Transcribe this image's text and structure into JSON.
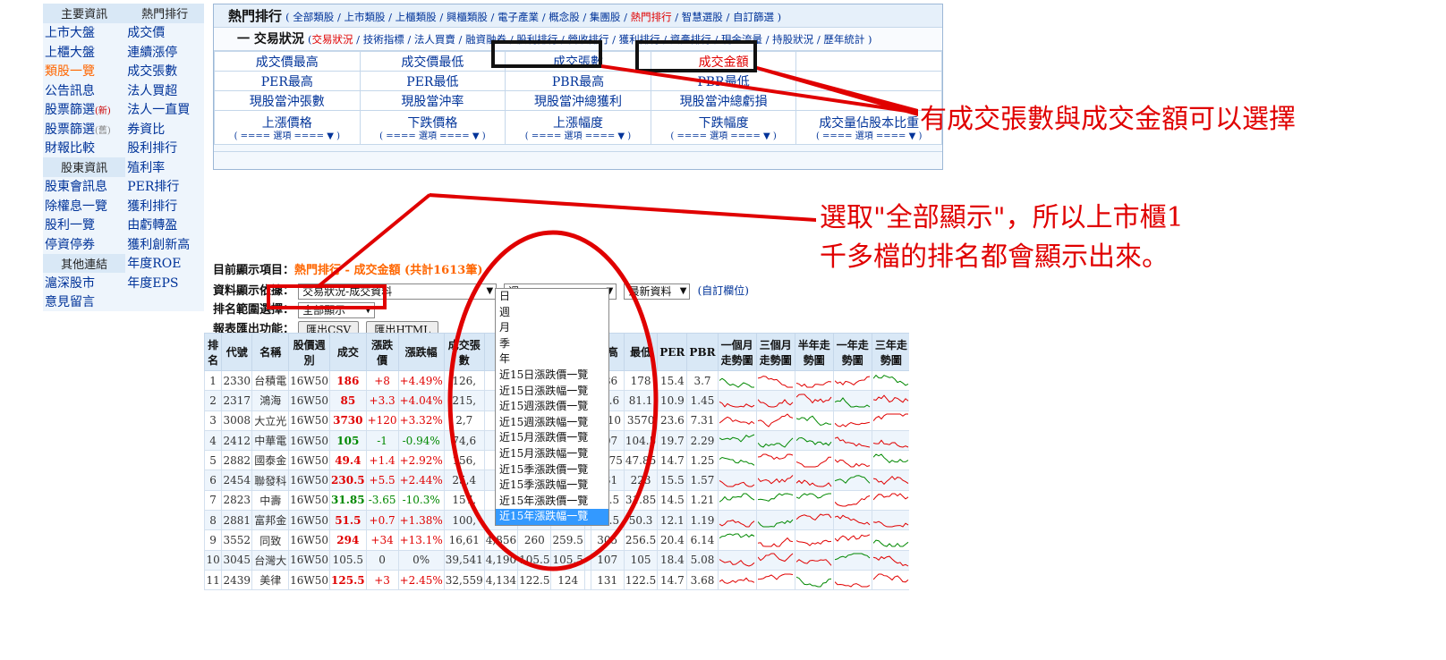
{
  "left_menu": {
    "rows": [
      {
        "a": "主要資訊",
        "a_hdr": true,
        "b": "熱門排行",
        "b_hdr": true
      },
      {
        "a": "上市大盤",
        "b": "成交價"
      },
      {
        "a": "上櫃大盤",
        "b": "連續漲停"
      },
      {
        "a": "類股一覽",
        "a_hl": true,
        "b": "成交張數"
      },
      {
        "a": "公告訊息",
        "b": "法人買超"
      },
      {
        "a": "股票篩選",
        "a_badge": "(新)",
        "b": "法人一直買"
      },
      {
        "a": "股票篩選",
        "a_badge": "(舊)",
        "a_badge_old": true,
        "b": "券資比"
      },
      {
        "a": "財報比較",
        "b": "股利排行"
      },
      {
        "a": "股東資訊",
        "a_hdr": true,
        "b": "殖利率"
      },
      {
        "a": "股東會訊息",
        "b": "PER排行"
      },
      {
        "a": "除權息一覽",
        "b": "獲利排行"
      },
      {
        "a": "股利一覽",
        "b": "由虧轉盈"
      },
      {
        "a": "停資停券",
        "b": "獲利創新高"
      },
      {
        "a": "其他連結",
        "a_hdr": true,
        "b": "年度ROE"
      },
      {
        "a": "滬深股市",
        "b": "年度EPS"
      },
      {
        "a": "意見留言",
        "b": ""
      }
    ]
  },
  "top_panel": {
    "title": "熱門排行",
    "title_links": "( 全部類股 / 上市類股 / 上櫃類股 / 興櫃類股 / 電子產業 / 概念股 / 集團股 / ",
    "title_current": "熱門排行",
    "title_links_end": " / 智慧選股 / 自訂篩選 )",
    "sub_title": "一 交易狀況",
    "sub_current": "交易狀況",
    "sub_links": " / 技術指標 / 法人買賣 / 融資融券 / 股利排行 / 營收排行 / 獲利排行 / 資產排行 / 現金流量 / 持股狀況 / 歷年統計 )",
    "grid": [
      [
        "成交價最高",
        "成交價最低",
        "成交張數",
        "成交金額",
        ""
      ],
      [
        "PER最高",
        "PER最低",
        "PBR最高",
        "PBR最低",
        ""
      ],
      [
        "現股當沖張數",
        "現股當沖率",
        "現股當沖總獲利",
        "現股當沖總虧損",
        ""
      ],
      [
        "上漲價格",
        "下跌價格",
        "上漲幅度",
        "下跌幅度",
        "成交量佔股本比重"
      ]
    ],
    "select_placeholder": "( ==== 選項 ==== ▼ )"
  },
  "status": {
    "current_label": "目前顯示項目：",
    "current_value": "熱門排行 - 成交金額 (共計1613筆)",
    "basis_label": "資料顯示依據：",
    "basis_value": "交易狀況-成交資料",
    "period_value": "週",
    "latest_value": "最新資料",
    "custom_cols": "(自訂欄位)",
    "range_label": "排名範圍選擇：",
    "range_value": "全部顯示",
    "export_label": "報表匯出功能：",
    "export_csv": "匯出CSV",
    "export_html": "匯出HTML"
  },
  "dropdown_options": [
    "日",
    "週",
    "月",
    "季",
    "年",
    "近15日漲跌價一覽",
    "近15日漲跌幅一覽",
    "近15週漲跌價一覽",
    "近15週漲跌幅一覽",
    "近15月漲跌價一覽",
    "近15月漲跌幅一覽",
    "近15季漲跌價一覽",
    "近15季漲跌幅一覽",
    "近15年漲跌價一覽",
    "近15年漲跌幅一覽"
  ],
  "dropdown_active_index": 14,
  "table": {
    "headers": [
      "排名",
      "代號",
      "名稱",
      "股價週別",
      "成交",
      "漲跌價",
      "漲跌幅",
      "成交張數",
      "",
      "",
      "",
      "",
      "最高",
      "最低",
      "PER",
      "PBR",
      "一個月走勢圖",
      "三個月走勢圖",
      "半年走勢圖",
      "一年走勢圖",
      "三年走勢圖"
    ],
    "rows": [
      [
        "1",
        "2330",
        "台積電",
        "16W50",
        "186",
        "+8",
        "+4.49%",
        "126,",
        "",
        "",
        "",
        "",
        "186",
        "178",
        "15.4",
        "3.7"
      ],
      [
        "2",
        "2317",
        "鴻海",
        "16W50",
        "85",
        "+3.3",
        "+4.04%",
        "215,",
        "",
        "",
        "",
        "",
        "85.6",
        "81.1",
        "10.9",
        "1.45"
      ],
      [
        "3",
        "3008",
        "大立光",
        "16W50",
        "3730",
        "+120",
        "+3.32%",
        "2,7",
        "",
        "",
        "",
        "",
        "3810",
        "3570",
        "23.6",
        "7.31"
      ],
      [
        "4",
        "2412",
        "中華電",
        "16W50",
        "105",
        "-1",
        "-0.94%",
        "74,6",
        "",
        "",
        "",
        "",
        "107",
        "104.5",
        "19.7",
        "2.29"
      ],
      [
        "5",
        "2882",
        "國泰金",
        "16W50",
        "49.4",
        "+1.4",
        "+2.92%",
        "156,",
        "",
        "",
        "",
        "",
        "49.75",
        "47.85",
        "14.7",
        "1.25"
      ],
      [
        "6",
        "2454",
        "聯發科",
        "16W50",
        "230.5",
        "+5.5",
        "+2.44%",
        "25,4",
        "",
        "",
        "",
        "",
        "231",
        "223",
        "15.5",
        "1.57"
      ],
      [
        "7",
        "2823",
        "中壽",
        "16W50",
        "31.85",
        "-3.65",
        "-10.3%",
        "157,",
        "",
        "",
        "",
        "",
        "35.5",
        "31.85",
        "14.5",
        "1.21"
      ],
      [
        "8",
        "2881",
        "富邦金",
        "16W50",
        "51.5",
        "+0.7",
        "+1.38%",
        "100,",
        "",
        "",
        "",
        "",
        "51.5",
        "50.3",
        "12.1",
        "1.19"
      ],
      [
        "9",
        "3552",
        "同致",
        "16W50",
        "294",
        "+34",
        "+13.1%",
        "16,61",
        "4,856",
        "260",
        "259.5",
        "",
        "305",
        "256.5",
        "20.4",
        "6.14"
      ],
      [
        "10",
        "3045",
        "台灣大",
        "16W50",
        "105.5",
        "0",
        "0%",
        "39,541",
        "4,190",
        "105.5",
        "105.5",
        "",
        "107",
        "105",
        "18.4",
        "5.08"
      ],
      [
        "11",
        "2439",
        "美律",
        "16W50",
        "125.5",
        "+3",
        "+2.45%",
        "32,559",
        "4,134",
        "122.5",
        "124",
        "",
        "131",
        "122.5",
        "14.7",
        "3.68"
      ]
    ]
  },
  "annotations": {
    "a1": "有成交張數與成交金額可以選擇",
    "a2_line1": "選取\"全部顯示\"，所以上市櫃1",
    "a2_line2": "千多檔的排名都會顯示出來。"
  }
}
